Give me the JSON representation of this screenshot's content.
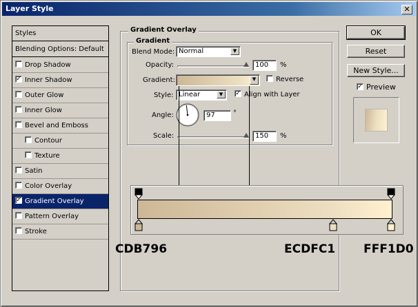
{
  "window": {
    "title": "Layer Style",
    "close_glyph": "✕"
  },
  "styles_list": {
    "header": "Styles",
    "blending": "Blending Options: Default",
    "items": [
      {
        "label": "Drop Shadow",
        "checked": false
      },
      {
        "label": "Inner Shadow",
        "checked": true
      },
      {
        "label": "Outer Glow",
        "checked": false
      },
      {
        "label": "Inner Glow",
        "checked": false
      },
      {
        "label": "Bevel and Emboss",
        "checked": false
      },
      {
        "label": "Contour",
        "checked": false
      },
      {
        "label": "Texture",
        "checked": false
      },
      {
        "label": "Satin",
        "checked": false
      },
      {
        "label": "Color Overlay",
        "checked": false
      },
      {
        "label": "Gradient Overlay",
        "checked": true,
        "selected": true
      },
      {
        "label": "Pattern Overlay",
        "checked": false
      },
      {
        "label": "Stroke",
        "checked": false
      }
    ]
  },
  "panel": {
    "title": "Gradient Overlay",
    "subtitle": "Gradient",
    "blend_mode_label": "Blend Mode:",
    "blend_mode_value": "Normal",
    "opacity_label": "Opacity:",
    "opacity_value": "100",
    "opacity_fraction": 1.0,
    "percent": "%",
    "gradient_label": "Gradient:",
    "reverse_label": "Reverse",
    "reverse_checked": false,
    "style_label": "Style:",
    "style_value": "Linear",
    "align_label": "Align with Layer",
    "align_checked": true,
    "angle_label": "Angle:",
    "angle_value": "97",
    "degree": "°",
    "scale_label": "Scale:",
    "scale_value": "150",
    "scale_fraction": 1.0
  },
  "buttons": {
    "ok": "OK",
    "reset": "Reset",
    "new_style": "New Style...",
    "preview_label": "Preview",
    "preview_checked": true
  },
  "gradient_stops": {
    "colors": [
      "#cdb796",
      "#ecdfc1",
      "#fff1d0"
    ],
    "labels": [
      "CDB796",
      "ECDFC1",
      "FFF1D0"
    ]
  },
  "icons": {
    "dropdown": "triangle-down",
    "check": "✓"
  }
}
